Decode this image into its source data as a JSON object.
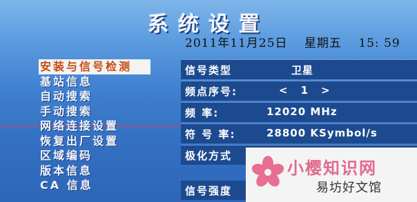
{
  "header": {
    "title": "系统设置",
    "date": "2011年11月25日",
    "weekday": "星期五",
    "time": "15: 59"
  },
  "menu": {
    "items": [
      {
        "label": "安装与信号检测",
        "selected": true
      },
      {
        "label": "基站信息",
        "selected": false
      },
      {
        "label": "自动搜索",
        "selected": false
      },
      {
        "label": "手动搜索",
        "selected": false
      },
      {
        "label": "网络连接设置",
        "selected": false
      },
      {
        "label": "恢复出厂设置",
        "selected": false
      },
      {
        "label": "区域编码",
        "selected": false
      },
      {
        "label": "版本信息",
        "selected": false
      },
      {
        "label": "CA 信息",
        "selected": false
      }
    ]
  },
  "panel": {
    "signal_type_label": "信号类型",
    "signal_type_value": "卫星",
    "freq_index_label": "频点序号:",
    "freq_index_left": "<",
    "freq_index_value": "1",
    "freq_index_right": ">",
    "frequency_label": "频  率:",
    "frequency_value": "12020 MHz",
    "symbol_rate_label": "符 号 率:",
    "symbol_rate_value": "28800 KSymbol/s",
    "polarization_label": "极化方式",
    "signal_strength_label": "信号强度"
  },
  "watermark": {
    "main": "小樱知识网",
    "sub": "易坊好文馆"
  }
}
